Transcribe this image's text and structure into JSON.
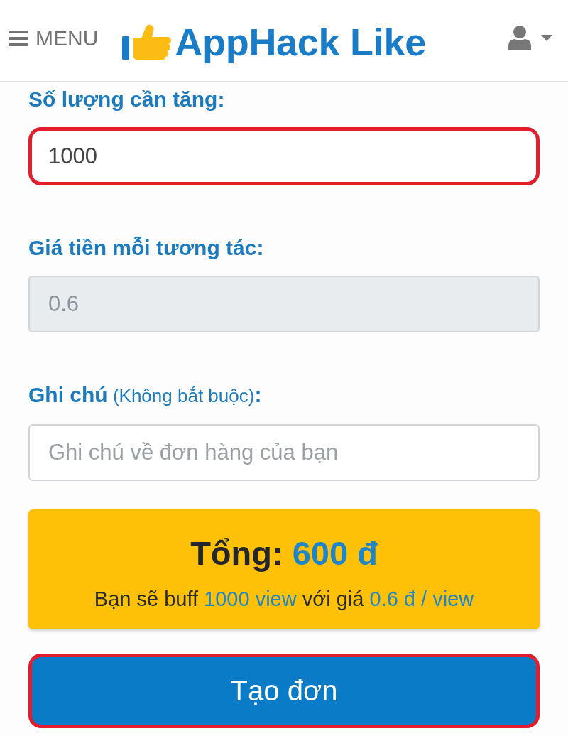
{
  "header": {
    "menu_label": "MENU",
    "brand": "AppHack Like"
  },
  "fields": [
    {
      "label": [
        {
          "kind": "strong",
          "text": "Số lượng cần tăng:"
        }
      ],
      "value": "1000",
      "disabled": false,
      "highlighted": true
    },
    {
      "label": [
        {
          "kind": "strong",
          "text": "Giá tiền mỗi tương tác:"
        }
      ],
      "value": "0.6",
      "disabled": true,
      "highlighted": false
    },
    {
      "label": [
        {
          "kind": "strong",
          "text": "Ghi chú"
        },
        {
          "kind": "note",
          "text": " (Không bắt buộc)"
        },
        {
          "kind": "strong",
          "text": ":"
        }
      ],
      "placeholder": "Ghi chú về đơn hàng của bạn",
      "disabled": false,
      "highlighted": false
    }
  ],
  "summary": {
    "total": [
      {
        "kind": "plain",
        "text": "Tổng: "
      },
      {
        "kind": "accent",
        "text": "600 đ"
      }
    ],
    "detail": [
      {
        "kind": "plain",
        "text": "Bạn sẽ buff "
      },
      {
        "kind": "accent",
        "text": "1000 view"
      },
      {
        "kind": "plain",
        "text": " với giá "
      },
      {
        "kind": "accent",
        "text": "0.6 đ / view"
      }
    ]
  },
  "submit_button": {
    "label": "Tạo đơn",
    "highlighted": true
  }
}
